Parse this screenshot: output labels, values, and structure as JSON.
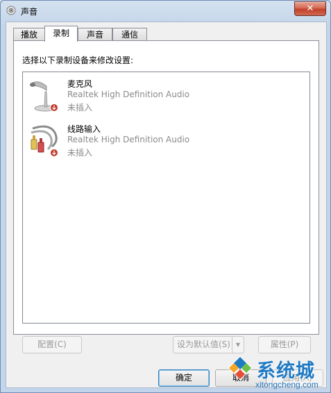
{
  "window": {
    "title": "声音",
    "close_label": "✕"
  },
  "tabs": [
    {
      "label": "播放",
      "active": false
    },
    {
      "label": "录制",
      "active": true
    },
    {
      "label": "声音",
      "active": false
    },
    {
      "label": "通信",
      "active": false
    }
  ],
  "panel": {
    "instruction": "选择以下录制设备来修改设置:"
  },
  "devices": [
    {
      "name": "麦克风",
      "description": "Realtek High Definition Audio",
      "status": "未插入",
      "icon": "microphone-icon"
    },
    {
      "name": "线路输入",
      "description": "Realtek High Definition Audio",
      "status": "未插入",
      "icon": "line-in-jack-icon"
    }
  ],
  "buttons": {
    "configure": "配置(C)",
    "set_default": "设为默认值(S)",
    "properties": "属性(P)",
    "ok": "确定",
    "cancel": "取消",
    "apply": "应用(A)"
  },
  "watermark": {
    "brand": "系统城",
    "url": "xitongcheng.com"
  },
  "colors": {
    "titlebar": "#c3d5ea",
    "close_button": "#c2402a",
    "brand_blue": "#1f7ac4",
    "disabled_text": "#9a9a9a"
  }
}
